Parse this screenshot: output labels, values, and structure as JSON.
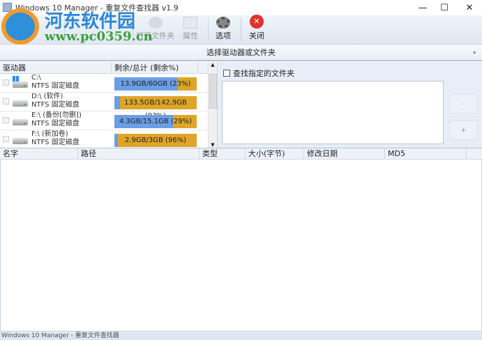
{
  "window": {
    "title": "Windows 10 Manager - 重复文件查找器 v1.9",
    "minimize": "—",
    "maximize": "☐",
    "close": "✕"
  },
  "toolbar": {
    "buttons": [
      {
        "label": "打开文件夹",
        "enabled": false
      },
      {
        "label": "属性",
        "enabled": false
      },
      {
        "label": "选项",
        "enabled": true
      },
      {
        "label": "关闭",
        "enabled": true
      }
    ]
  },
  "section": {
    "title": "选择驱动器或文件夹",
    "chevron": "»"
  },
  "drives": {
    "columns": [
      "驱动器",
      "剩余/总计 (剩余%)"
    ],
    "items": [
      {
        "name": "C:\\",
        "fs": "NTFS 固定磁盘",
        "usage": "13.9GB/60GB (23%)",
        "free_percent": 23,
        "windows": true
      },
      {
        "name": "D:\\ (软件)",
        "fs": "NTFS 固定磁盘",
        "usage": "133.5GB/142.9GB (93%)",
        "free_percent": 93
      },
      {
        "name": "E:\\ (备份[勿删])",
        "fs": "NTFS 固定磁盘",
        "usage": "4.3GB/15.1GB (29%)",
        "free_percent": 29
      },
      {
        "name": "F:\\ (新加卷)",
        "fs": "NTFS 固定磁盘",
        "usage": "2.9GB/3GB (96%)",
        "free_percent": 96
      }
    ]
  },
  "folder": {
    "checkbox_label": "查找指定的文件夹",
    "remove": "-",
    "add": "+"
  },
  "files": {
    "columns": [
      "名字",
      "路径",
      "类型",
      "大小(字节)",
      "修改日期",
      "MD5"
    ]
  },
  "status": {
    "text": "Windows 10 Manager - 重复文件查找器"
  },
  "watermark": {
    "site": "河东软件园",
    "url": "www.pc0359.cn"
  }
}
